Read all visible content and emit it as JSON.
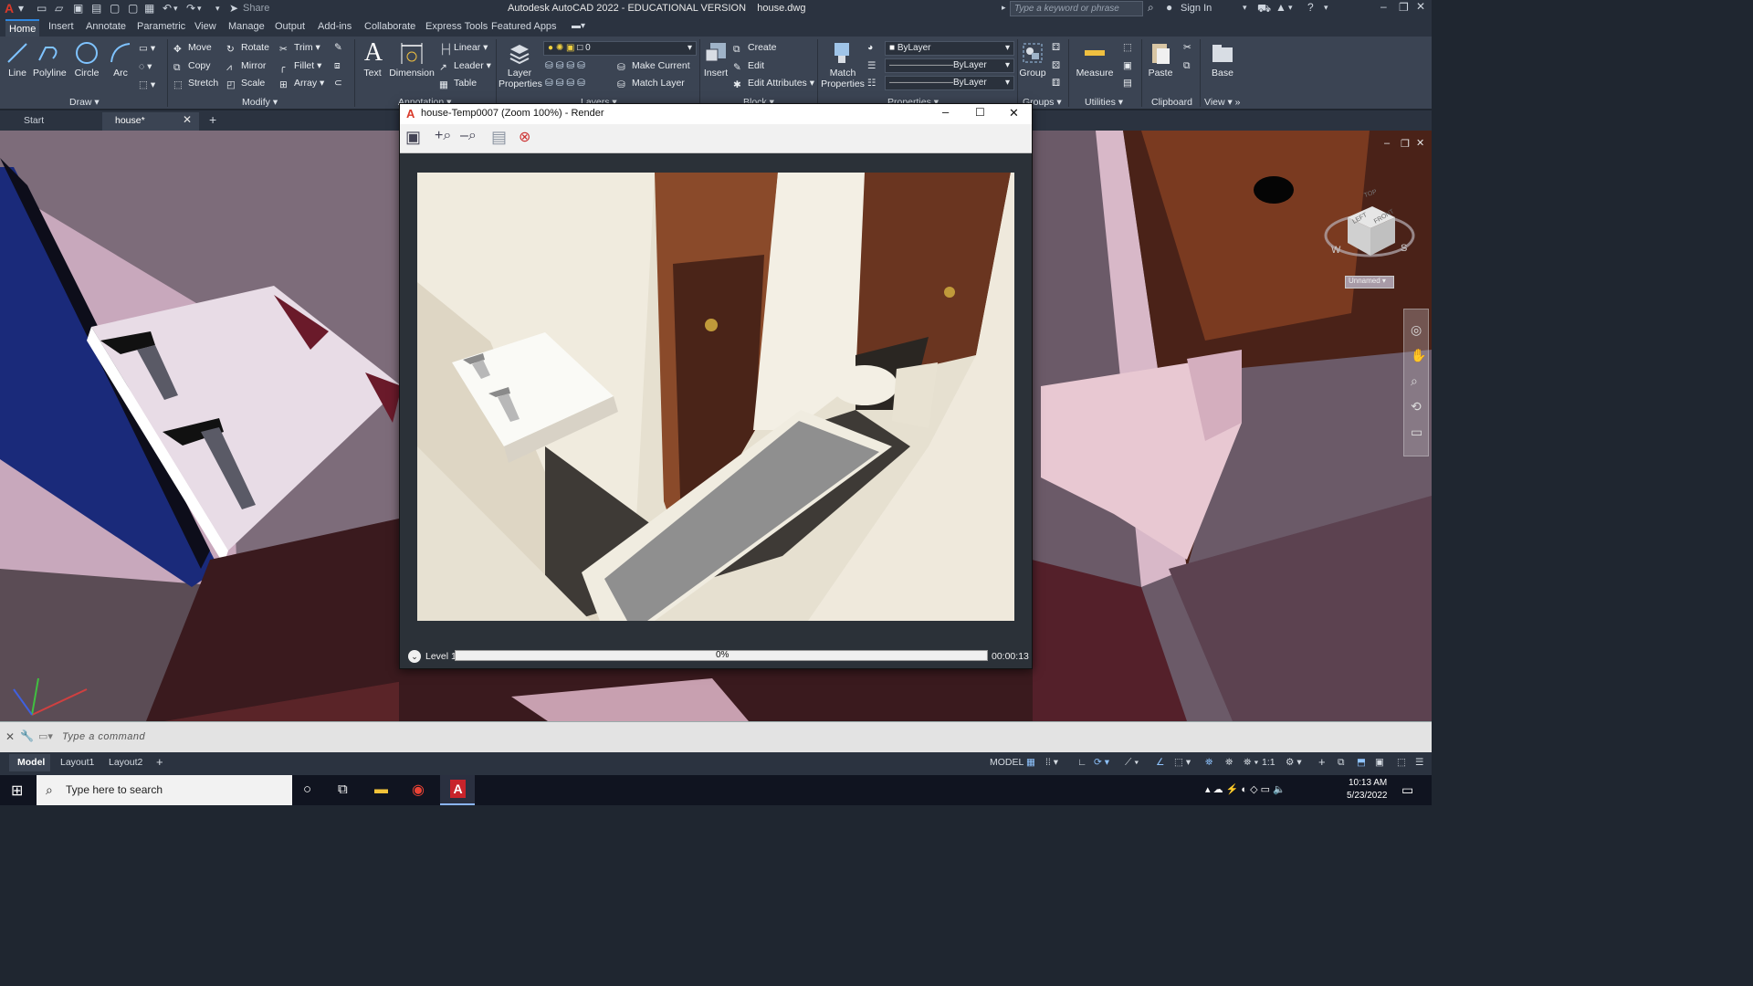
{
  "titlebar": {
    "app_title": "Autodesk AutoCAD 2022 - EDUCATIONAL VERSION",
    "file_name": "house.dwg",
    "share_label": "Share",
    "search_placeholder": "Type a keyword or phrase",
    "sign_in": "Sign In"
  },
  "ribbon_tabs": [
    "Home",
    "Insert",
    "Annotate",
    "Parametric",
    "View",
    "Manage",
    "Output",
    "Add-ins",
    "Collaborate",
    "Express Tools",
    "Featured Apps"
  ],
  "ribbon": {
    "draw": {
      "line": "Line",
      "polyline": "Polyline",
      "circle": "Circle",
      "arc": "Arc",
      "panel": "Draw"
    },
    "modify": {
      "move": "Move",
      "rotate": "Rotate",
      "trim": "Trim",
      "copy": "Copy",
      "mirror": "Mirror",
      "fillet": "Fillet",
      "stretch": "Stretch",
      "scale": "Scale",
      "array": "Array",
      "panel": "Modify"
    },
    "annotation": {
      "text": "Text",
      "dimension": "Dimension",
      "linear": "Linear",
      "leader": "Leader",
      "table": "Table",
      "panel": "Annotation"
    },
    "layers": {
      "layer_properties_1": "Layer",
      "layer_properties_2": "Properties",
      "layer_value": "0",
      "make_current": "Make Current",
      "match_layer": "Match Layer",
      "panel": "Layers"
    },
    "block": {
      "insert": "Insert",
      "create": "Create",
      "edit": "Edit",
      "edit_attributes": "Edit Attributes",
      "panel": "Block"
    },
    "properties": {
      "match_1": "Match",
      "match_2": "Properties",
      "color": "ByLayer",
      "linetype": "ByLayer",
      "lineweight": "ByLayer",
      "panel": "Properties"
    },
    "groups": {
      "group": "Group",
      "panel": "Groups"
    },
    "utilities": {
      "measure": "Measure",
      "panel": "Utilities"
    },
    "clipboard": {
      "paste": "Paste",
      "panel": "Clipboard"
    },
    "view": {
      "base": "Base",
      "panel": "View"
    }
  },
  "doc_tabs": {
    "start": "Start",
    "house": "house*"
  },
  "viewcube": {
    "top": "TOP",
    "left": "LEFT",
    "front": "FRONT",
    "s": "S",
    "w": "W",
    "unnamed": "Unnamed"
  },
  "render_window": {
    "title": "house-Temp0007 (Zoom 100%) - Render",
    "level": "Level 1",
    "progress_text": "0%",
    "progress": 0,
    "time": "00:00:13"
  },
  "command": {
    "placeholder": "Type a command"
  },
  "layout_tabs": [
    "Model",
    "Layout1",
    "Layout2"
  ],
  "status": {
    "model": "MODEL",
    "scale": "1:1"
  },
  "taskbar": {
    "search": "Type here to search",
    "time": "10:13 AM",
    "date": "5/23/2022"
  },
  "colors": {
    "accent": "#2e86de",
    "ribbon_bg": "#3b4453",
    "title_bg": "#2b3340"
  }
}
